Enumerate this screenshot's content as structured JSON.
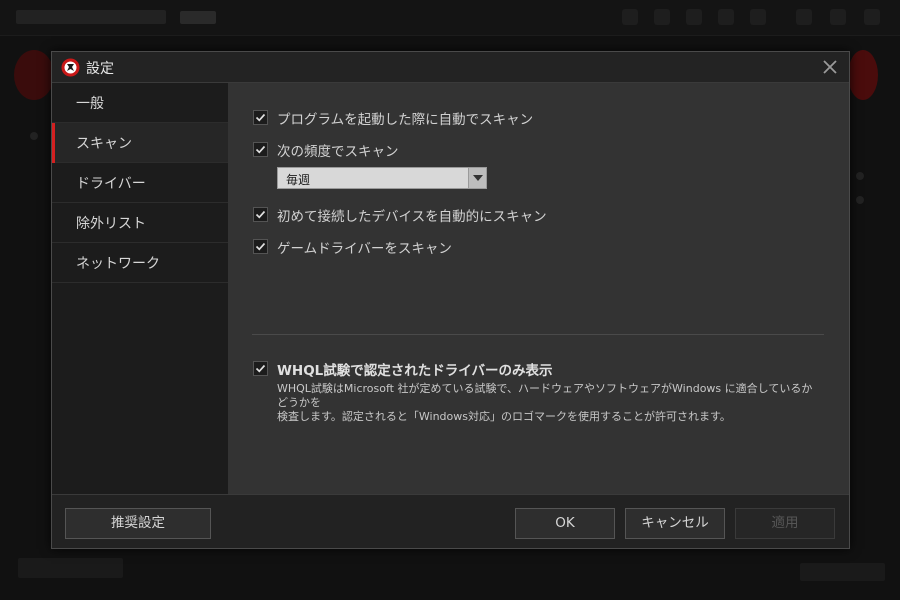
{
  "dialog": {
    "title": "設定",
    "logo_icon": "logo-icon",
    "close_icon": "close-icon"
  },
  "sidebar": {
    "items": [
      {
        "label": "一般",
        "active": false
      },
      {
        "label": "スキャン",
        "active": true
      },
      {
        "label": "ドライバー",
        "active": false
      },
      {
        "label": "除外リスト",
        "active": false
      },
      {
        "label": "ネットワーク",
        "active": false
      }
    ]
  },
  "scan": {
    "options": [
      {
        "label": "プログラムを起動した際に自動でスキャン",
        "checked": true
      },
      {
        "label": "次の頻度でスキャン",
        "checked": true
      },
      {
        "label": "初めて接続したデバイスを自動的にスキャン",
        "checked": true
      },
      {
        "label": "ゲームドライバーをスキャン",
        "checked": true
      }
    ],
    "frequency": {
      "selected": "毎週"
    },
    "whql": {
      "label": "WHQL試験で認定されたドライバーのみ表示",
      "checked": true,
      "desc_line1": "WHQL試験はMicrosoft 社が定めている試験で、ハードウェアやソフトウェアがWindows に適合しているかどうかを",
      "desc_line2": "検査します。認定されると「Windows対応」のロゴマークを使用することが許可されます。"
    }
  },
  "footer": {
    "recommended_label": "推奨設定",
    "ok_label": "OK",
    "cancel_label": "キャンセル",
    "apply_label": "適用",
    "apply_enabled": false
  },
  "colors": {
    "accent": "#d42020",
    "dialog_bg": "#333333",
    "sidebar_bg": "#1c1c1c"
  }
}
